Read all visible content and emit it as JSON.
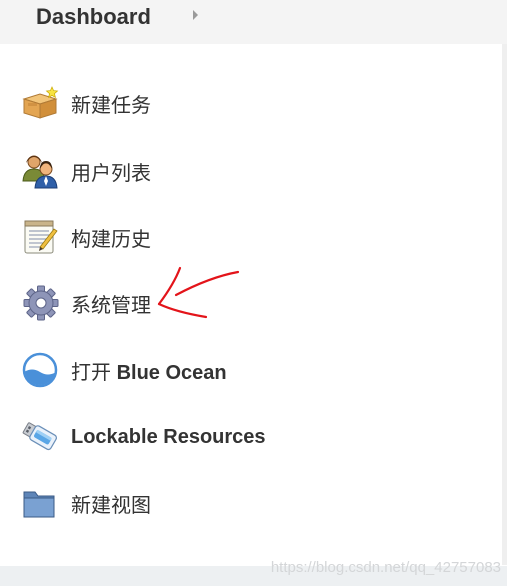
{
  "header": {
    "breadcrumb_title": "Dashboard",
    "chevron_icon": "chevron-right-icon"
  },
  "sidebar": {
    "items": [
      {
        "label": "新建任务",
        "icon": "new-item-box-icon"
      },
      {
        "label": "用户列表",
        "icon": "users-icon"
      },
      {
        "label": "构建历史",
        "icon": "notepad-icon"
      },
      {
        "label": "系统管理",
        "icon": "gear-icon"
      },
      {
        "label": "打开",
        "label_bold": "Blue Ocean",
        "icon": "blue-ocean-icon"
      },
      {
        "label_bold": "Lockable Resources",
        "icon": "usb-drive-icon"
      },
      {
        "label": "新建视图",
        "icon": "folder-icon"
      }
    ]
  },
  "annotation": {
    "color": "#e3141a"
  },
  "watermark": {
    "text": "https://blog.csdn.net/qq_42757083"
  },
  "colors": {
    "header_bg": "#f4f4f4",
    "text": "#333333",
    "annotation_red": "#e3141a"
  }
}
